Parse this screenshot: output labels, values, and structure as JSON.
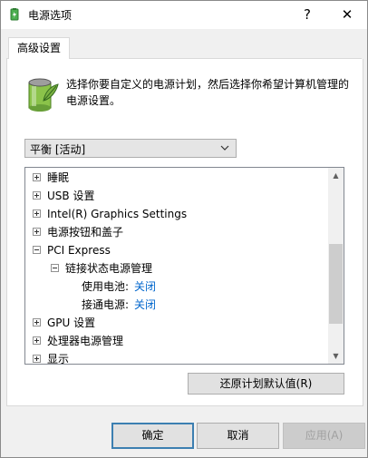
{
  "window": {
    "title": "电源选项",
    "help_label": "?",
    "close_label": "✕"
  },
  "tabs": [
    {
      "label": "高级设置"
    }
  ],
  "description": "选择你要自定义的电源计划，然后选择你希望计算机管理的电源设置。",
  "plan_select": {
    "value": "平衡 [活动]"
  },
  "tree": {
    "items": [
      {
        "label": "睡眠",
        "expander": "+"
      },
      {
        "label": "USB 设置",
        "expander": "+"
      },
      {
        "label": "Intel(R) Graphics Settings",
        "expander": "+"
      },
      {
        "label": "电源按钮和盖子",
        "expander": "+"
      },
      {
        "label": "PCI Express",
        "expander": "-"
      },
      {
        "label": "链接状态电源管理",
        "expander": "-"
      },
      {
        "label": "使用电池:",
        "value": "关闭"
      },
      {
        "label": "接通电源:",
        "value": "关闭"
      },
      {
        "label": "GPU 设置",
        "expander": "+"
      },
      {
        "label": "处理器电源管理",
        "expander": "+"
      },
      {
        "label": "显示",
        "expander": "+"
      }
    ]
  },
  "buttons": {
    "restore_defaults": "还原计划默认值(R)",
    "ok": "确定",
    "cancel": "取消",
    "apply": "应用(A)"
  },
  "colors": {
    "link": "#0066cc",
    "default_button_border": "#3c7fb1"
  }
}
